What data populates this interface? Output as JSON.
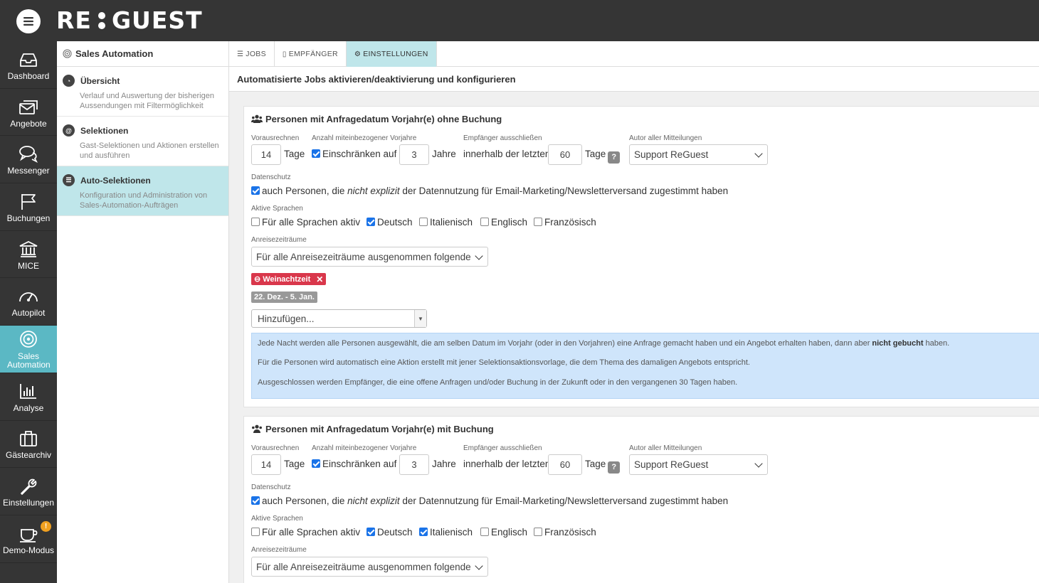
{
  "app": {
    "logo_left": "RE",
    "logo_right": "GUEST"
  },
  "nav": [
    {
      "label": "Dashboard",
      "icon": "inbox-icon"
    },
    {
      "label": "Angebote",
      "icon": "envelopes-icon"
    },
    {
      "label": "Messenger",
      "icon": "chat-icon"
    },
    {
      "label": "Buchungen",
      "icon": "flag-icon"
    },
    {
      "label": "MICE",
      "icon": "building-icon"
    },
    {
      "label": "Autopilot",
      "icon": "gauge-icon"
    },
    {
      "label": "Sales Automation",
      "icon": "target-icon",
      "active": true
    },
    {
      "label": "Analyse",
      "icon": "chart-icon"
    },
    {
      "label": "Gästearchiv",
      "icon": "briefcase-icon"
    },
    {
      "label": "Einstellungen",
      "icon": "wrench-icon"
    },
    {
      "label": "Demo-Modus",
      "icon": "coffee-icon",
      "badge": "!"
    }
  ],
  "subnav": {
    "title": "Sales Automation",
    "items": [
      {
        "title": "Übersicht",
        "desc": "Verlauf und Auswertung der bisherigen Aussendungen mit Filtermöglichkeit"
      },
      {
        "title": "Selektionen",
        "desc": "Gast-Selektionen und Aktionen erstellen und ausführen"
      },
      {
        "title": "Auto-Selektionen",
        "desc": "Konfiguration und Administration von Sales-Automation-Aufträgen",
        "active": true
      }
    ]
  },
  "tabs": [
    {
      "label": "JOBS"
    },
    {
      "label": "EMPFÄNGER"
    },
    {
      "label": "EINSTELLUNGEN",
      "active": true
    }
  ],
  "page_title": "Automatisierte Jobs aktivieren/deaktivierung und konfigurieren",
  "labels": {
    "vorausrechnen": "Vorausrechnen",
    "anzahl": "Anzahl miteinbezogener Vorjahre",
    "empfaenger": "Empfänger ausschließen",
    "autor": "Autor aller Mitteilungen",
    "tage": "Tage",
    "einschraenken": "Einschränken auf",
    "jahre": "Jahre",
    "innerhalb": "innerhalb der letzten",
    "help": "?",
    "datenschutz": "Datenschutz",
    "ds_pre": "auch Personen, die ",
    "ds_em": "nicht explizit",
    "ds_post": " der Datennutzung für Email-Marketing/Newsletterversand zugestimmt haben",
    "sprachen": "Aktive Sprachen",
    "alle_sprachen": "Für alle Sprachen aktiv",
    "deutsch": "Deutsch",
    "italienisch": "Italienisch",
    "englisch": "Englisch",
    "franzoesisch": "Französisch",
    "anreise": "Anreisezeiträume"
  },
  "jobs": [
    {
      "title": "Personen mit Anfragedatum Vorjahr(e) ohne Buchung",
      "vorausrechnen": "14",
      "jahre": "3",
      "tage": "60",
      "autor": "Support ReGuest",
      "einschraenken": true,
      "datenschutz": true,
      "sprachen": {
        "alle": false,
        "deutsch": true,
        "italienisch": false,
        "englisch": false,
        "franzoesisch": false
      },
      "anreise": "Für alle Anreisezeiträume ausgenommen folgende",
      "period_tag": "Weinachtzeit",
      "period_dates": "22. Dez. - 5. Jan.",
      "add_placeholder": "Hinzufügen...",
      "info": {
        "p1a": "Jede Nacht werden alle Personen ausgewählt, die am selben Datum im Vorjahr (oder in den Vorjahren) eine Anfrage gemacht haben und ein Angebot erhalten haben, dann aber",
        "p1b": "nicht gebucht",
        "p1c": "haben.",
        "p2": "Für die Personen wird automatisch eine Aktion erstellt mit jener Selektionsaktionsvorlage, die dem Thema des damaligen Angebots entspricht.",
        "p3": "Ausgeschlossen werden Empfänger, die eine offene Anfragen und/oder Buchung in der Zukunft oder in den vergangenen 30 Tagen haben."
      }
    },
    {
      "title": "Personen mit Anfragedatum Vorjahr(e) mit Buchung",
      "vorausrechnen": "14",
      "jahre": "3",
      "tage": "60",
      "autor": "Support ReGuest",
      "einschraenken": true,
      "datenschutz": true,
      "sprachen": {
        "alle": false,
        "deutsch": true,
        "italienisch": true,
        "englisch": false,
        "franzoesisch": false
      },
      "anreise": "Für alle Anreisezeiträume ausgenommen folgende"
    }
  ]
}
